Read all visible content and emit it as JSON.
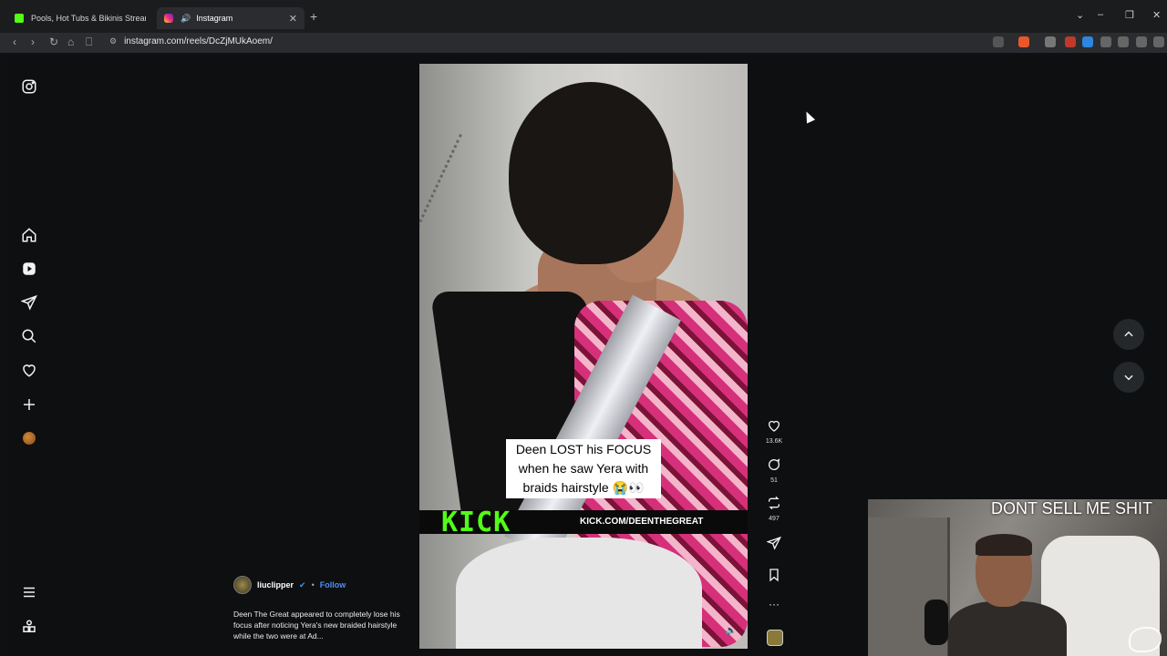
{
  "browser": {
    "tabs": [
      {
        "title": "Pools, Hot Tubs & Bikinis Streaming",
        "active": false
      },
      {
        "title": "Instagram",
        "active": true
      }
    ],
    "url": "instagram.com/reels/DcZjMUkAoem/",
    "window_controls": {
      "minimize": "–",
      "restore": "❐",
      "close": "✕"
    }
  },
  "sidebar": {
    "items": [
      "instagram-logo",
      "home",
      "reels",
      "messages",
      "search",
      "notifications",
      "create",
      "profile",
      "more",
      "also-from-meta"
    ]
  },
  "reel": {
    "caption_overlay": "Deen LOST his FOCUS when he saw Yera with braids hairstyle 😭👀",
    "kick_logo": "KICK",
    "kick_url": "KICK.COM/DEENTHEGREAT",
    "likes": "13.6K",
    "comments": "51",
    "reposts": "497",
    "author": "liuclipper",
    "follow_label": "Follow",
    "separator": "•",
    "description": "Deen The Great appeared to completely lose his focus after noticing Yera's new braided hairstyle while the two were at Ad..."
  },
  "webcam": {
    "overlay_text": "DONT SELL ME SHIT"
  },
  "colors": {
    "kick_green": "#53fc18",
    "follow_blue": "#4f8ff7",
    "page_bg": "#0d0f11"
  }
}
